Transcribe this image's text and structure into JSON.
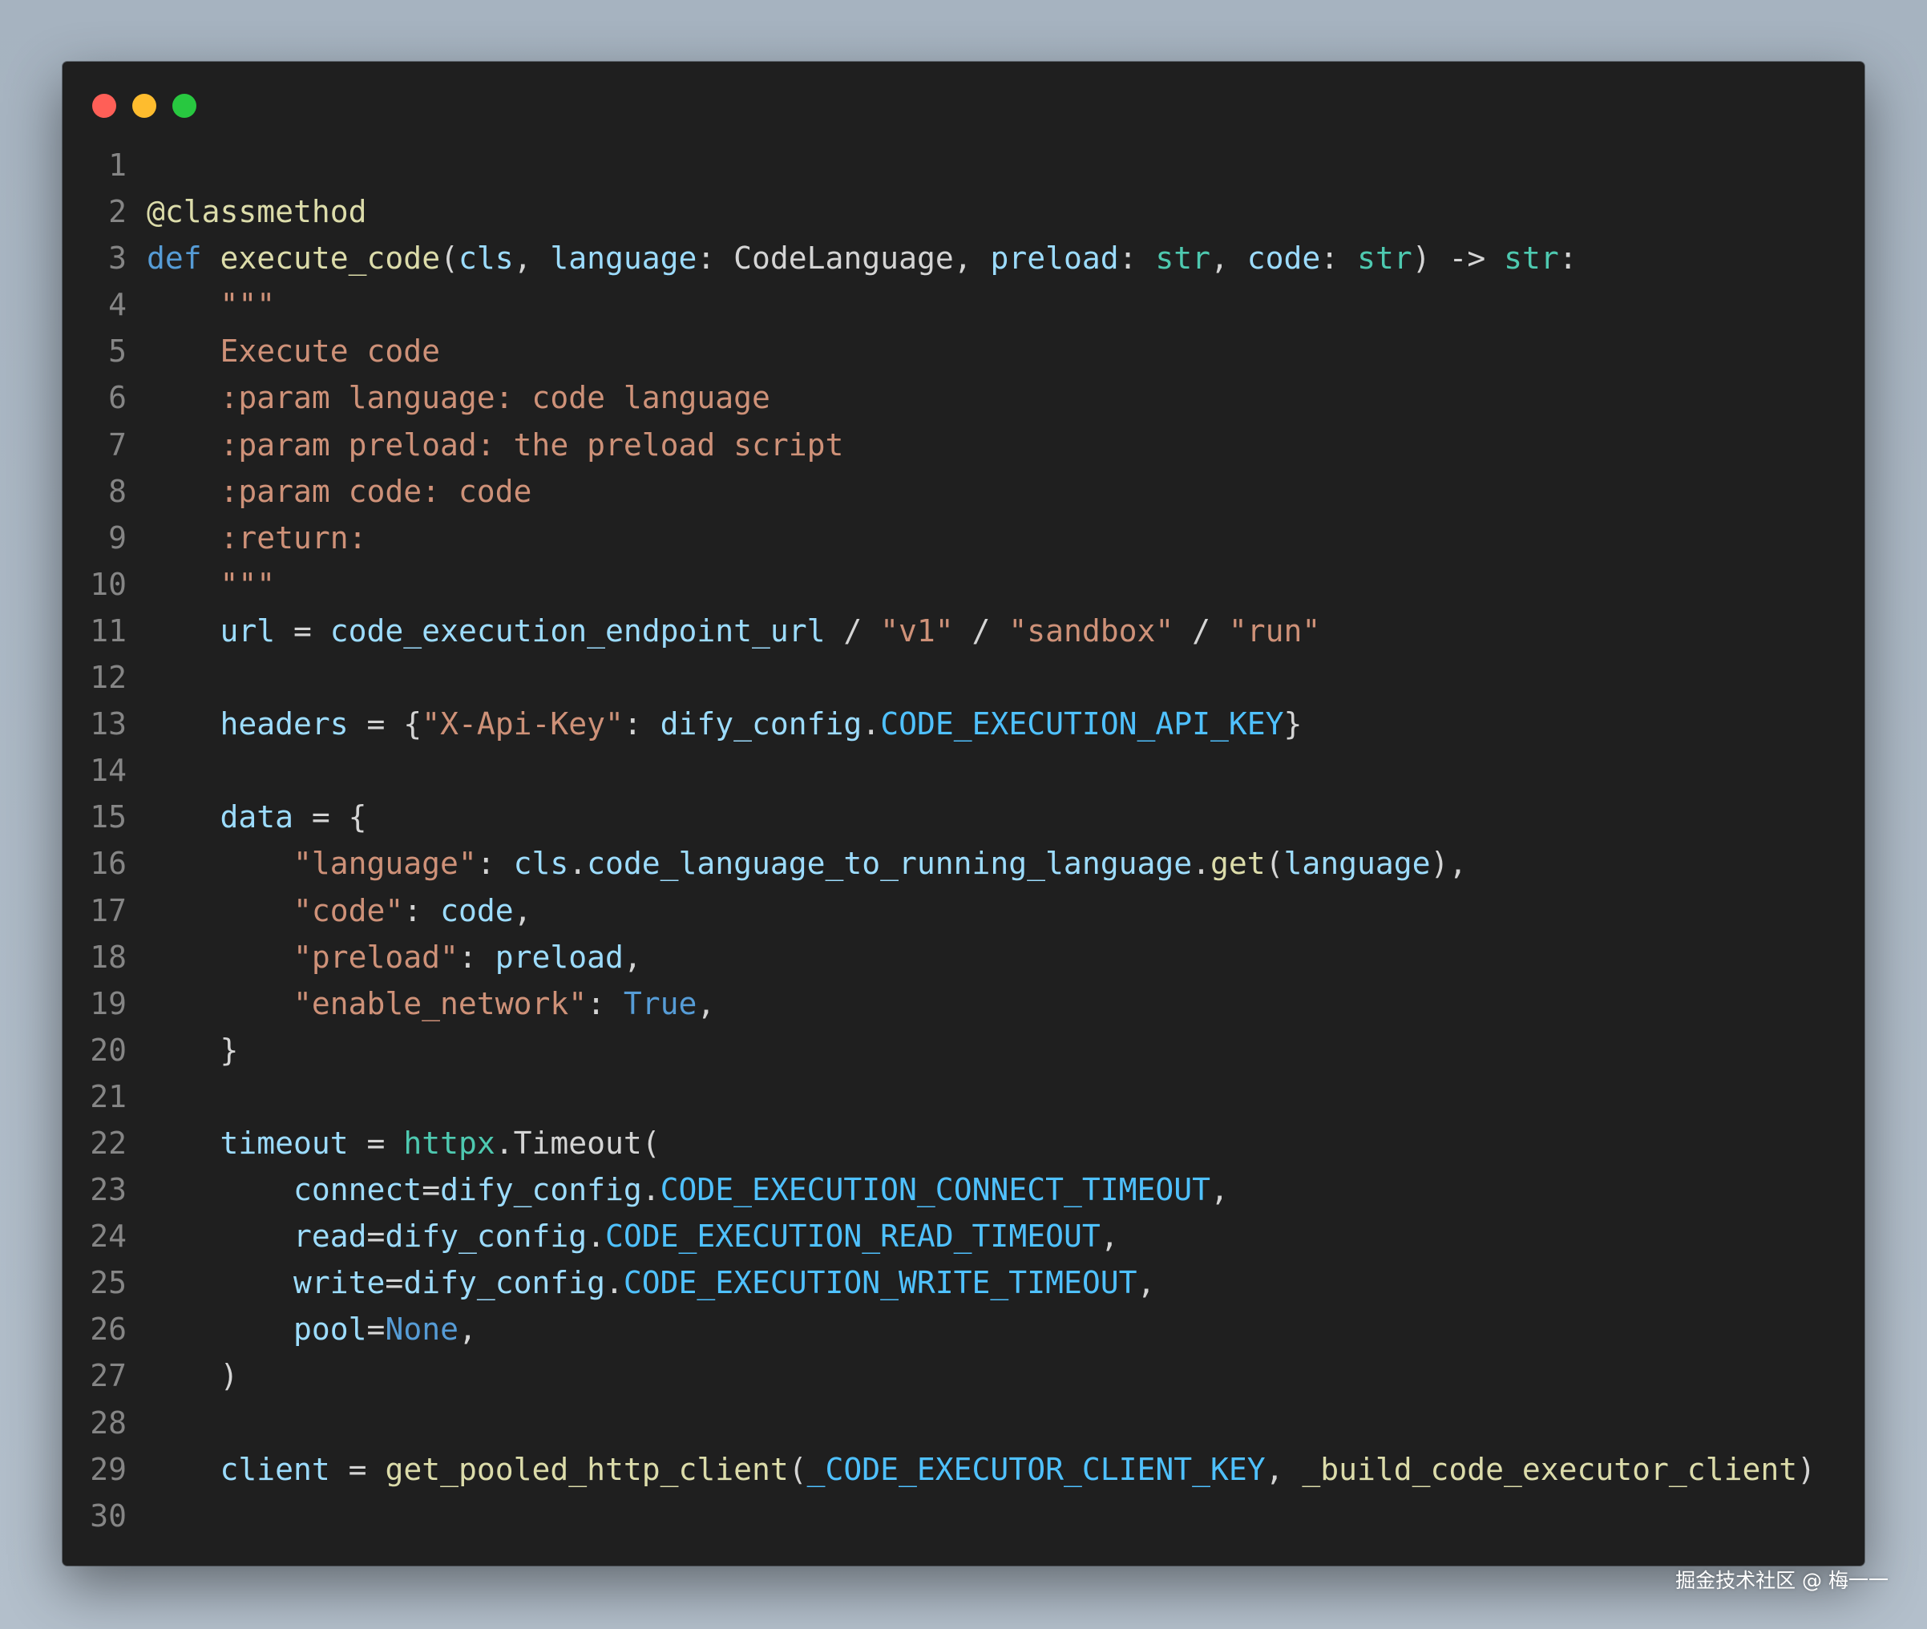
{
  "window": {
    "traffic_lights": [
      {
        "name": "close",
        "color": "#ff5f57"
      },
      {
        "name": "minimize",
        "color": "#febc2e"
      },
      {
        "name": "zoom",
        "color": "#28c840"
      }
    ]
  },
  "colors": {
    "keyword": "#569cd6",
    "function": "#dcdcaa",
    "variable": "#9cdcfe",
    "builtin_type": "#4ec9b0",
    "string": "#ce9178",
    "constant": "#4fc1ff",
    "plain": "#d4d4d4",
    "line_number": "#858585",
    "background": "#1f1f1f"
  },
  "code": {
    "lines": [
      {
        "num": "1",
        "tokens": []
      },
      {
        "num": "2",
        "tokens": [
          {
            "t": "@classmethod",
            "c": "function"
          }
        ]
      },
      {
        "num": "3",
        "tokens": [
          {
            "t": "def",
            "c": "keyword"
          },
          {
            "t": " ",
            "c": "plain"
          },
          {
            "t": "execute_code",
            "c": "function"
          },
          {
            "t": "(",
            "c": "plain"
          },
          {
            "t": "cls",
            "c": "variable"
          },
          {
            "t": ", ",
            "c": "plain"
          },
          {
            "t": "language",
            "c": "variable"
          },
          {
            "t": ": CodeLanguage, ",
            "c": "plain"
          },
          {
            "t": "preload",
            "c": "variable"
          },
          {
            "t": ": ",
            "c": "plain"
          },
          {
            "t": "str",
            "c": "builtin_type"
          },
          {
            "t": ", ",
            "c": "plain"
          },
          {
            "t": "code",
            "c": "variable"
          },
          {
            "t": ": ",
            "c": "plain"
          },
          {
            "t": "str",
            "c": "builtin_type"
          },
          {
            "t": ") -> ",
            "c": "plain"
          },
          {
            "t": "str",
            "c": "builtin_type"
          },
          {
            "t": ":",
            "c": "plain"
          }
        ]
      },
      {
        "num": "4",
        "tokens": [
          {
            "t": "    \"\"\"",
            "c": "string"
          }
        ]
      },
      {
        "num": "5",
        "tokens": [
          {
            "t": "    Execute code",
            "c": "string"
          }
        ]
      },
      {
        "num": "6",
        "tokens": [
          {
            "t": "    :param language: code language",
            "c": "string"
          }
        ]
      },
      {
        "num": "7",
        "tokens": [
          {
            "t": "    :param preload: the preload script",
            "c": "string"
          }
        ]
      },
      {
        "num": "8",
        "tokens": [
          {
            "t": "    :param code: code",
            "c": "string"
          }
        ]
      },
      {
        "num": "9",
        "tokens": [
          {
            "t": "    :return:",
            "c": "string"
          }
        ]
      },
      {
        "num": "10",
        "tokens": [
          {
            "t": "    \"\"\"",
            "c": "string"
          }
        ]
      },
      {
        "num": "11",
        "tokens": [
          {
            "t": "    ",
            "c": "plain"
          },
          {
            "t": "url",
            "c": "variable"
          },
          {
            "t": " = ",
            "c": "plain"
          },
          {
            "t": "code_execution_endpoint_url",
            "c": "variable"
          },
          {
            "t": " / ",
            "c": "plain"
          },
          {
            "t": "\"v1\"",
            "c": "string"
          },
          {
            "t": " / ",
            "c": "plain"
          },
          {
            "t": "\"sandbox\"",
            "c": "string"
          },
          {
            "t": " / ",
            "c": "plain"
          },
          {
            "t": "\"run\"",
            "c": "string"
          }
        ]
      },
      {
        "num": "12",
        "tokens": []
      },
      {
        "num": "13",
        "tokens": [
          {
            "t": "    ",
            "c": "plain"
          },
          {
            "t": "headers",
            "c": "variable"
          },
          {
            "t": " = {",
            "c": "plain"
          },
          {
            "t": "\"X-Api-Key\"",
            "c": "string"
          },
          {
            "t": ": ",
            "c": "plain"
          },
          {
            "t": "dify_config",
            "c": "variable"
          },
          {
            "t": ".",
            "c": "plain"
          },
          {
            "t": "CODE_EXECUTION_API_KEY",
            "c": "constant"
          },
          {
            "t": "}",
            "c": "plain"
          }
        ]
      },
      {
        "num": "14",
        "tokens": []
      },
      {
        "num": "15",
        "tokens": [
          {
            "t": "    ",
            "c": "plain"
          },
          {
            "t": "data",
            "c": "variable"
          },
          {
            "t": " = {",
            "c": "plain"
          }
        ]
      },
      {
        "num": "16",
        "tokens": [
          {
            "t": "        ",
            "c": "plain"
          },
          {
            "t": "\"language\"",
            "c": "string"
          },
          {
            "t": ": ",
            "c": "plain"
          },
          {
            "t": "cls",
            "c": "variable"
          },
          {
            "t": ".",
            "c": "plain"
          },
          {
            "t": "code_language_to_running_language",
            "c": "variable"
          },
          {
            "t": ".",
            "c": "plain"
          },
          {
            "t": "get",
            "c": "function"
          },
          {
            "t": "(",
            "c": "plain"
          },
          {
            "t": "language",
            "c": "variable"
          },
          {
            "t": "),",
            "c": "plain"
          }
        ]
      },
      {
        "num": "17",
        "tokens": [
          {
            "t": "        ",
            "c": "plain"
          },
          {
            "t": "\"code\"",
            "c": "string"
          },
          {
            "t": ": ",
            "c": "plain"
          },
          {
            "t": "code",
            "c": "variable"
          },
          {
            "t": ",",
            "c": "plain"
          }
        ]
      },
      {
        "num": "18",
        "tokens": [
          {
            "t": "        ",
            "c": "plain"
          },
          {
            "t": "\"preload\"",
            "c": "string"
          },
          {
            "t": ": ",
            "c": "plain"
          },
          {
            "t": "preload",
            "c": "variable"
          },
          {
            "t": ",",
            "c": "plain"
          }
        ]
      },
      {
        "num": "19",
        "tokens": [
          {
            "t": "        ",
            "c": "plain"
          },
          {
            "t": "\"enable_network\"",
            "c": "string"
          },
          {
            "t": ": ",
            "c": "plain"
          },
          {
            "t": "True",
            "c": "keyword"
          },
          {
            "t": ",",
            "c": "plain"
          }
        ]
      },
      {
        "num": "20",
        "tokens": [
          {
            "t": "    }",
            "c": "plain"
          }
        ]
      },
      {
        "num": "21",
        "tokens": []
      },
      {
        "num": "22",
        "tokens": [
          {
            "t": "    ",
            "c": "plain"
          },
          {
            "t": "timeout",
            "c": "variable"
          },
          {
            "t": " = ",
            "c": "plain"
          },
          {
            "t": "httpx",
            "c": "builtin_type"
          },
          {
            "t": ".Timeout(",
            "c": "plain"
          }
        ]
      },
      {
        "num": "23",
        "tokens": [
          {
            "t": "        ",
            "c": "plain"
          },
          {
            "t": "connect",
            "c": "variable"
          },
          {
            "t": "=",
            "c": "plain"
          },
          {
            "t": "dify_config",
            "c": "variable"
          },
          {
            "t": ".",
            "c": "plain"
          },
          {
            "t": "CODE_EXECUTION_CONNECT_TIMEOUT",
            "c": "constant"
          },
          {
            "t": ",",
            "c": "plain"
          }
        ]
      },
      {
        "num": "24",
        "tokens": [
          {
            "t": "        ",
            "c": "plain"
          },
          {
            "t": "read",
            "c": "variable"
          },
          {
            "t": "=",
            "c": "plain"
          },
          {
            "t": "dify_config",
            "c": "variable"
          },
          {
            "t": ".",
            "c": "plain"
          },
          {
            "t": "CODE_EXECUTION_READ_TIMEOUT",
            "c": "constant"
          },
          {
            "t": ",",
            "c": "plain"
          }
        ]
      },
      {
        "num": "25",
        "tokens": [
          {
            "t": "        ",
            "c": "plain"
          },
          {
            "t": "write",
            "c": "variable"
          },
          {
            "t": "=",
            "c": "plain"
          },
          {
            "t": "dify_config",
            "c": "variable"
          },
          {
            "t": ".",
            "c": "plain"
          },
          {
            "t": "CODE_EXECUTION_WRITE_TIMEOUT",
            "c": "constant"
          },
          {
            "t": ",",
            "c": "plain"
          }
        ]
      },
      {
        "num": "26",
        "tokens": [
          {
            "t": "        ",
            "c": "plain"
          },
          {
            "t": "pool",
            "c": "variable"
          },
          {
            "t": "=",
            "c": "plain"
          },
          {
            "t": "None",
            "c": "keyword"
          },
          {
            "t": ",",
            "c": "plain"
          }
        ]
      },
      {
        "num": "27",
        "tokens": [
          {
            "t": "    )",
            "c": "plain"
          }
        ]
      },
      {
        "num": "28",
        "tokens": []
      },
      {
        "num": "29",
        "tokens": [
          {
            "t": "    ",
            "c": "plain"
          },
          {
            "t": "client",
            "c": "variable"
          },
          {
            "t": " = ",
            "c": "plain"
          },
          {
            "t": "get_pooled_http_client",
            "c": "function"
          },
          {
            "t": "(",
            "c": "plain"
          },
          {
            "t": "_CODE_EXECUTOR_CLIENT_KEY",
            "c": "constant"
          },
          {
            "t": ", ",
            "c": "plain"
          },
          {
            "t": "_build_code_executor_client",
            "c": "function"
          },
          {
            "t": ")",
            "c": "plain"
          }
        ]
      },
      {
        "num": "30",
        "tokens": []
      }
    ]
  },
  "watermark": "掘金技术社区 @ 梅一一"
}
